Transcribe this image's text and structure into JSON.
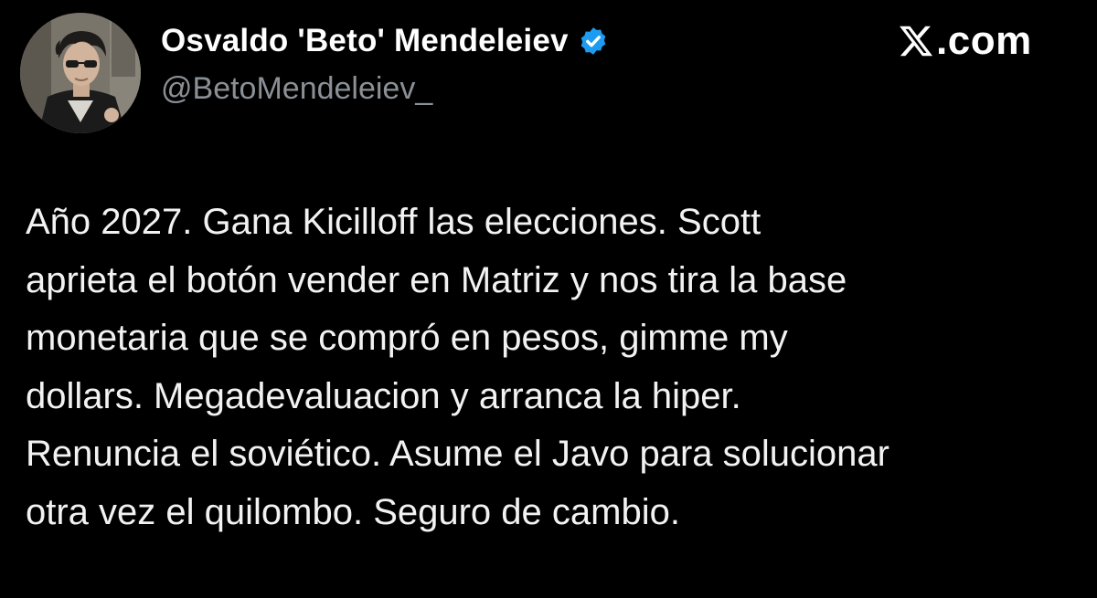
{
  "author": {
    "name": "Osvaldo 'Beto' Mendeleiev",
    "handle": "@BetoMendeleiev_",
    "verified": true,
    "avatar_icon": "profile-photo-avatar",
    "verified_icon": "verified-badge-icon"
  },
  "source": {
    "logo_icon": "x-logo-icon",
    "text": ".com"
  },
  "tweet": {
    "lines": [
      "Año 2027. Gana Kicilloff las elecciones. Scott",
      "aprieta el botón vender en Matriz y nos tira la base",
      "monetaria que se compró en pesos, gimme my",
      "dollars. Megadevaluacion y arranca la hiper.",
      "Renuncia el soviético. Asume el Javo para solucionar",
      "otra vez el quilombo. Seguro de cambio."
    ]
  },
  "colors": {
    "background": "#000000",
    "text": "#f2f2f2",
    "handle": "#8b9096",
    "verified": "#1d9bf0"
  }
}
